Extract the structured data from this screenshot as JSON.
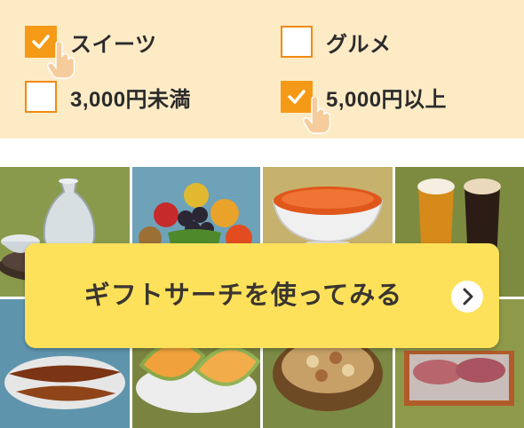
{
  "filters": [
    {
      "label": "スイーツ",
      "checked": true,
      "pointer": true
    },
    {
      "label": "グルメ",
      "checked": false,
      "pointer": false
    },
    {
      "label": "3,000円未満",
      "checked": false,
      "pointer": false
    },
    {
      "label": "5,000円以上",
      "checked": true,
      "pointer": true
    }
  ],
  "cta": {
    "label": "ギフトサーチを使ってみる",
    "icon": "chevron-right-icon"
  },
  "product_tiles": [
    {
      "name": "sake-carafe-photo"
    },
    {
      "name": "fruit-basket-photo"
    },
    {
      "name": "salmon-roe-bowl-photo"
    },
    {
      "name": "beer-glasses-photo"
    },
    {
      "name": "grilled-eel-photo"
    },
    {
      "name": "melon-slices-photo"
    },
    {
      "name": "mixed-nuts-photo"
    },
    {
      "name": "wagyu-beef-photo"
    }
  ],
  "colors": {
    "panel_bg": "#fdebc6",
    "checkbox_accent": "#f59a17",
    "cta_bg": "#fde15a",
    "text": "#2b2b2b"
  }
}
